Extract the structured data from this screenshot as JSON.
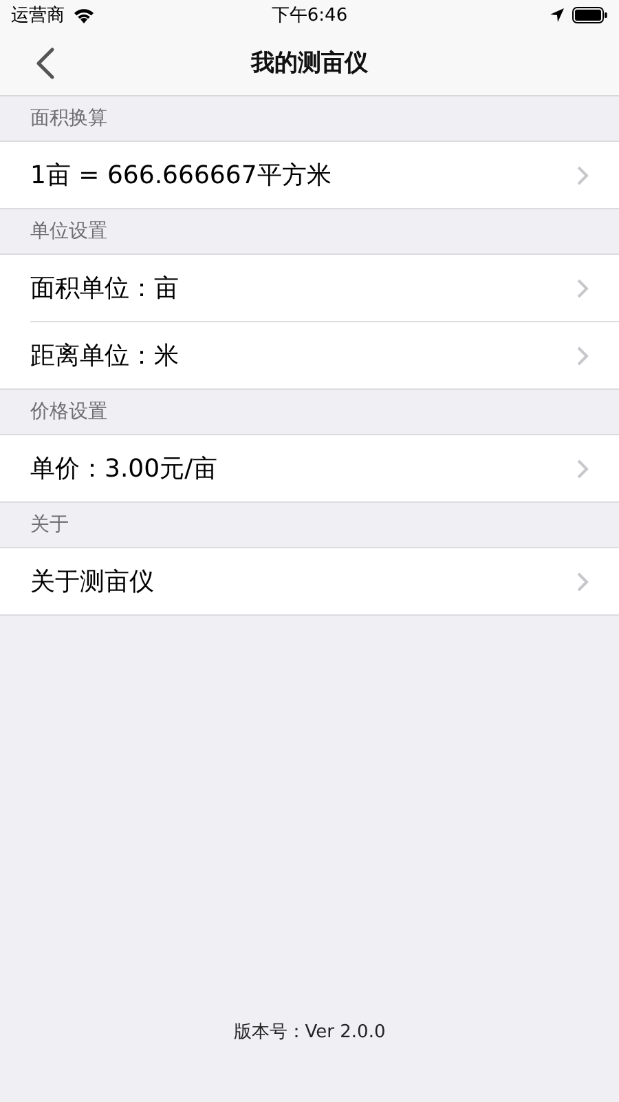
{
  "status_bar": {
    "carrier": "运营商",
    "time": "下午6:46"
  },
  "nav": {
    "title": "我的测亩仪"
  },
  "sections": [
    {
      "header": "面积换算",
      "rows": [
        {
          "label": "1亩 = 666.666667平方米"
        }
      ]
    },
    {
      "header": "单位设置",
      "rows": [
        {
          "label": "面积单位：亩"
        },
        {
          "label": "距离单位：米"
        }
      ]
    },
    {
      "header": "价格设置",
      "rows": [
        {
          "label": "单价：3.00元/亩"
        }
      ]
    },
    {
      "header": "关于",
      "rows": [
        {
          "label": "关于测亩仪"
        }
      ]
    }
  ],
  "footer": "版本号：Ver 2.0.0"
}
